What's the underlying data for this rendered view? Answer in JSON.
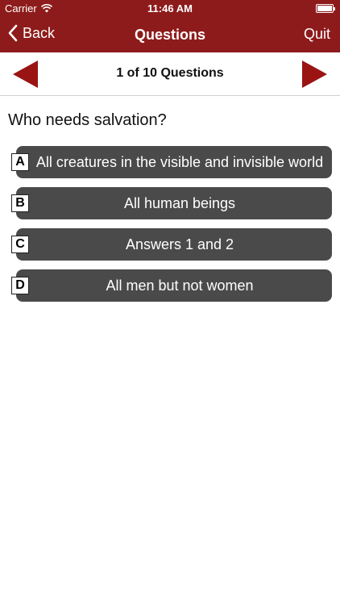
{
  "status_bar": {
    "carrier": "Carrier",
    "time": "11:46 AM",
    "battery_level": 1.0
  },
  "nav": {
    "back_label": "Back",
    "title": "Questions",
    "quit_label": "Quit"
  },
  "question_nav": {
    "counter": "1 of 10 Questions",
    "prev_icon": "left-triangle-arrow",
    "next_icon": "right-triangle-arrow"
  },
  "question": {
    "text": "Who needs salvation?"
  },
  "answers": [
    {
      "letter": "A",
      "text": "All creatures in the visible and invisible world"
    },
    {
      "letter": "B",
      "text": "All human beings"
    },
    {
      "letter": "C",
      "text": "Answers 1 and 2"
    },
    {
      "letter": "D",
      "text": "All men but not women"
    }
  ],
  "colors": {
    "brand": "#8e1b1b",
    "arrow": "#9a1414",
    "answer_bg": "#4a4a4a"
  }
}
